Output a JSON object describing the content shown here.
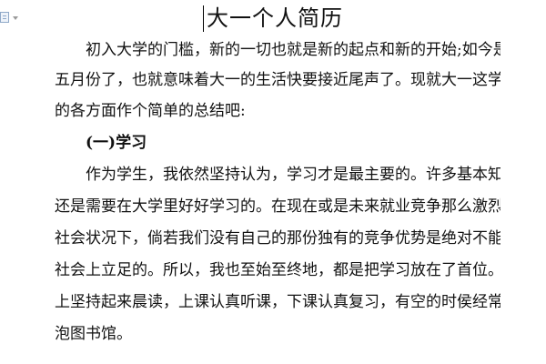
{
  "document": {
    "title": "大一个人简历",
    "lines": [
      "初入大学的门槛，新的一切也就是新的起点和新的开始;如今是",
      "五月份了，也就意味着大一的生活快要接近尾声了。现就大一这学年",
      "的各方面作个简单的总结吧:",
      "(一)学习",
      "作为学生，我依然坚持认为，学习才是最主要的。许多基本知识",
      "还是需要在大学里好好学习的。在现在或是未来就业竞争那么激烈的",
      "社会状况下，倘若我们没有自己的那份独有的竞争优势是绝对不能在",
      "社会上立足的。所以，我也至始至终地，都是把学习放在了首位。早",
      "上坚持起来晨读，上课认真听课，下课认真复习，有空的时侯经常去",
      "泡图书馆。"
    ]
  },
  "icons": {
    "page": "document-icon",
    "dropdown": "chevron-down-icon"
  }
}
